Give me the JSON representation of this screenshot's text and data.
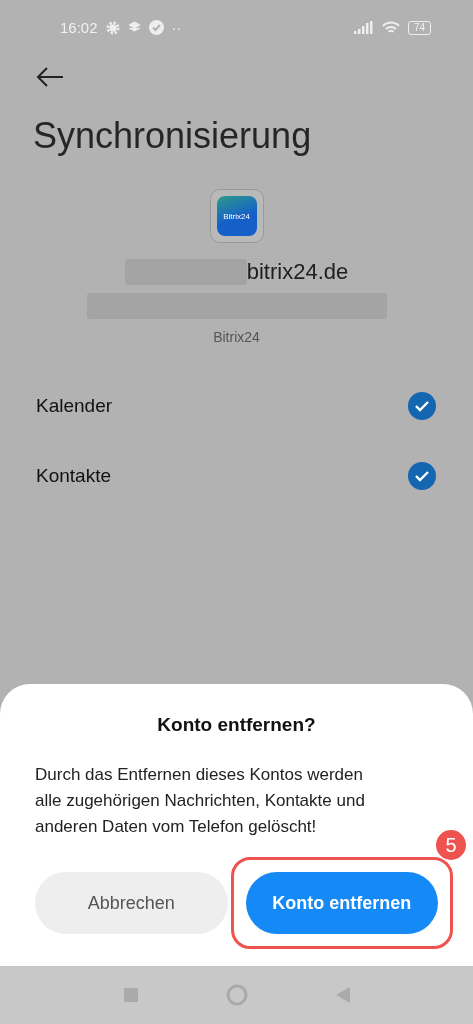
{
  "status_bar": {
    "time": "16:02",
    "more": "··",
    "battery": "74"
  },
  "header": {
    "title": "Synchronisierung"
  },
  "account": {
    "app_icon_label": "Bitrix24",
    "email_visible": "bitrix24.de",
    "type": "Bitrix24"
  },
  "sync_items": [
    {
      "label": "Kalender",
      "checked": true
    },
    {
      "label": "Kontakte",
      "checked": true
    }
  ],
  "dialog": {
    "title": "Konto entfernen?",
    "message": "Durch das Entfernen dieses Kontos werden alle zugehörigen Nachrichten, Kontakte und anderen Daten vom Telefon gelöscht!",
    "buttons": [
      {
        "label": "Abbrechen",
        "kind": "secondary"
      },
      {
        "label": "Konto entfernen",
        "kind": "primary"
      }
    ],
    "step_badge": "5"
  }
}
